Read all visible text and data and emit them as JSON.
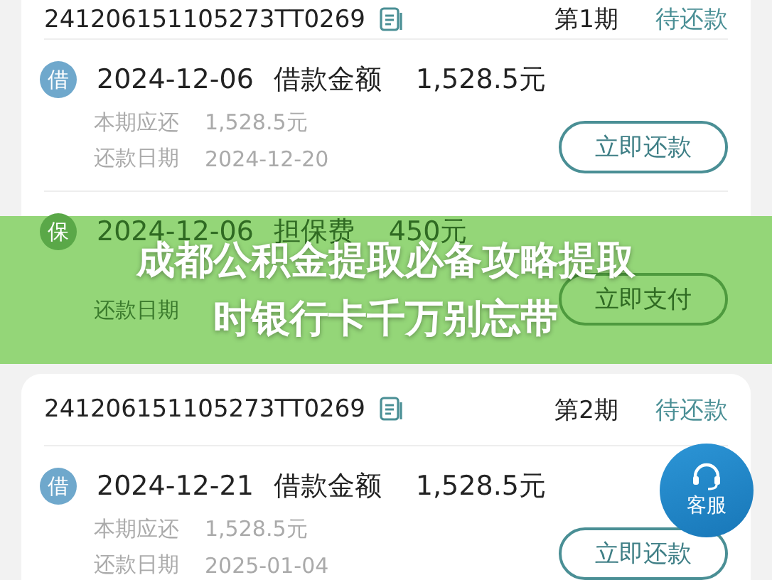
{
  "orders": [
    {
      "number": "241206151105273TT0269",
      "period": "第1期",
      "status": "待还款",
      "entries": [
        {
          "badge": "借",
          "date": "2024-12-06",
          "label": "借款金额",
          "amount": "1,528.5元",
          "details": [
            {
              "label": "本期应还",
              "value": "1,528.5元"
            },
            {
              "label": "还款日期",
              "value": "2024-12-20"
            }
          ],
          "button": "立即还款"
        },
        {
          "badge": "保",
          "date": "2024-12-06",
          "label": "担保费",
          "amount": "450元",
          "details": [
            {
              "label": "还款日期"
            }
          ],
          "button": "立即支付",
          "covered": true
        }
      ]
    },
    {
      "number": "241206151105273TT0269",
      "period": "第2期",
      "status": "待还款",
      "entries": [
        {
          "badge": "借",
          "date": "2024-12-21",
          "label": "借款金额",
          "amount": "1,528.5元",
          "details": [
            {
              "label": "本期应还",
              "value": "1,528.5元"
            },
            {
              "label": "还款日期",
              "value": "2025-01-04"
            }
          ],
          "button": "立即还款"
        }
      ]
    }
  ],
  "headline": [
    "成都公积金提取必备攻略提取",
    "时银行卡千万别忘带"
  ],
  "service_button": {
    "label": "客服"
  }
}
